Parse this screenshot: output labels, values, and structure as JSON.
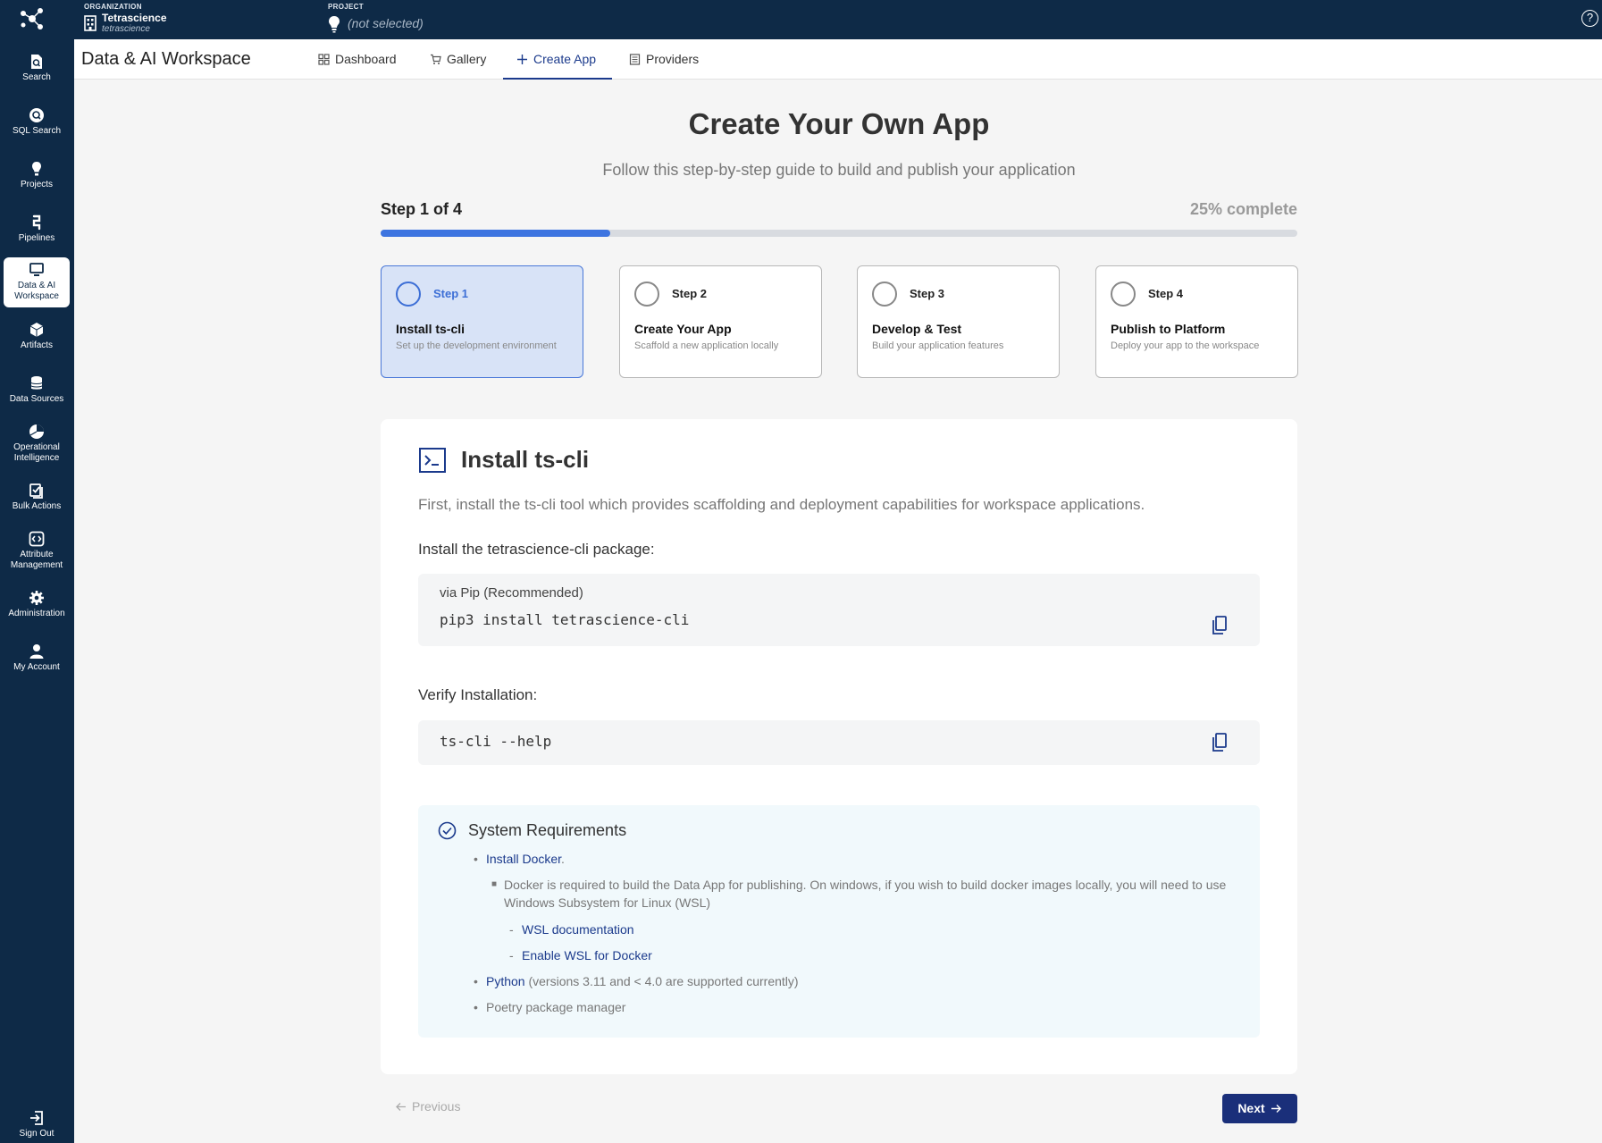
{
  "topbar": {
    "org_caption": "ORGANIZATION",
    "org_name": "Tetrascience",
    "org_sub": "tetrascience",
    "project_caption": "PROJECT",
    "project_value": "(not selected)",
    "help_glyph": "?"
  },
  "sidebar": {
    "items": [
      {
        "label": "Search",
        "icon": "search-doc-icon"
      },
      {
        "label": "SQL Search",
        "icon": "sql-search-icon"
      },
      {
        "label": "Projects",
        "icon": "bulb-icon"
      },
      {
        "label": "Pipelines",
        "icon": "pipeline-icon"
      },
      {
        "label": "Data & AI Workspace",
        "icon": "monitor-icon"
      },
      {
        "label": "Artifacts",
        "icon": "cube-icon"
      },
      {
        "label": "Data Sources",
        "icon": "database-icon"
      },
      {
        "label": "Operational Intelligence",
        "icon": "chart-icon"
      },
      {
        "label": "Bulk Actions",
        "icon": "bulk-icon"
      },
      {
        "label": "Attribute Management",
        "icon": "attribute-icon"
      },
      {
        "label": "Administration",
        "icon": "gear-icon"
      },
      {
        "label": "My Account",
        "icon": "user-icon"
      },
      {
        "label": "Sign Out",
        "icon": "sign-out-icon"
      }
    ]
  },
  "header": {
    "title": "Data & AI Workspace",
    "tabs": [
      {
        "label": "Dashboard",
        "icon": "grid-icon"
      },
      {
        "label": "Gallery",
        "icon": "cart-icon"
      },
      {
        "label": "Create App",
        "icon": "plus-icon",
        "active": true
      },
      {
        "label": "Providers",
        "icon": "list-icon"
      }
    ]
  },
  "main": {
    "title": "Create Your Own App",
    "subtitle": "Follow this step-by-step guide to build and publish your application",
    "step_count": "Step 1 of 4",
    "percent_text": "25% complete",
    "progress": 0.25,
    "steps": [
      {
        "step": "Step 1",
        "title": "Install ts-cli",
        "desc": "Set up the development environment",
        "active": true
      },
      {
        "step": "Step 2",
        "title": "Create Your App",
        "desc": "Scaffold a new application locally"
      },
      {
        "step": "Step 3",
        "title": "Develop & Test",
        "desc": "Build your application features"
      },
      {
        "step": "Step 4",
        "title": "Publish to Platform",
        "desc": "Deploy your app to the workspace"
      }
    ]
  },
  "panel": {
    "title": "Install ts-cli",
    "intro": "First, install the ts-cli tool which provides scaffolding and deployment capabilities for workspace applications.",
    "install_label": "Install the tetrascience-cli package:",
    "via": "via Pip (Recommended)",
    "install_cmd": "pip3 install tetrascience-cli",
    "verify_label": "Verify Installation:",
    "verify_cmd": "ts-cli --help",
    "requirements": {
      "title": "System Requirements",
      "docker_link": "Install Docker",
      "docker_period": ".",
      "docker_note": "Docker is required to build the Data App for publishing. On windows, if you wish to build docker images locally, you will need to use Windows Subsystem for Linux (WSL)",
      "wsl_doc": "WSL documentation",
      "wsl_enable": "Enable WSL for Docker",
      "python_link": "Python",
      "python_note": " (versions 3.11 and < 4.0 are supported currently)",
      "poetry": "Poetry package manager"
    }
  },
  "footer": {
    "previous": "Previous",
    "next": "Next"
  },
  "colors": {
    "nav_bg": "#0e2a47",
    "accent": "#3d74e0",
    "primary_button": "#1a2f7a"
  }
}
